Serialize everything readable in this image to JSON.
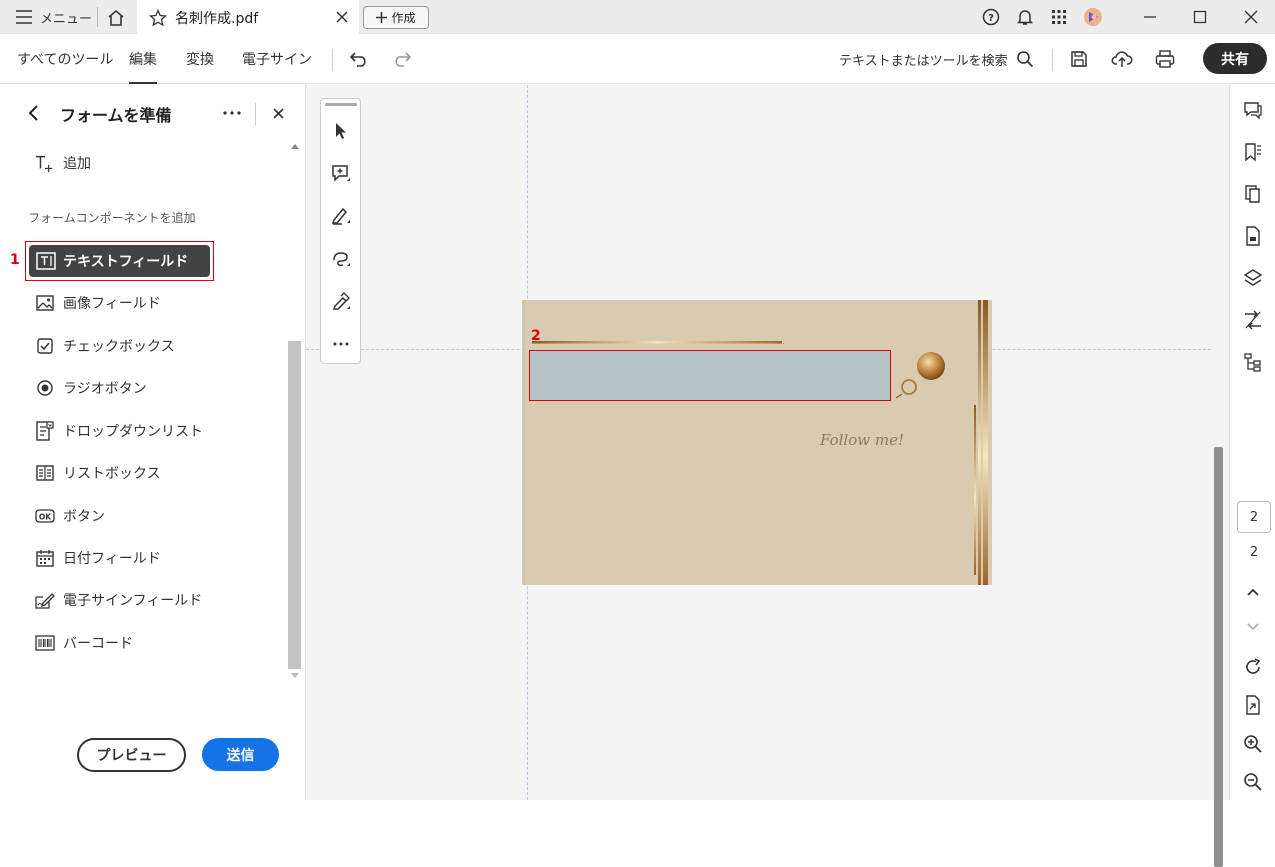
{
  "titlebar": {
    "menu_label": "メニュー",
    "tab_title": "名刺作成.pdf",
    "create_label": "作成"
  },
  "toolbar": {
    "menus": [
      "すべてのツール",
      "編集",
      "変換",
      "電子サイン"
    ],
    "active_menu": "編集",
    "search_label": "テキストまたはツールを検索",
    "share_label": "共有"
  },
  "sidebar": {
    "title": "フォームを準備",
    "add_label": "追加",
    "section_label": "フォームコンポーネントを追加",
    "selected_item": "テキストフィールド",
    "items": [
      {
        "label": "画像フィールド",
        "icon": "image-icon"
      },
      {
        "label": "チェックボックス",
        "icon": "checkbox-icon"
      },
      {
        "label": "ラジオボタン",
        "icon": "radio-icon"
      },
      {
        "label": "ドロップダウンリスト",
        "icon": "dropdown-icon"
      },
      {
        "label": "リストボックス",
        "icon": "listbox-icon"
      },
      {
        "label": "ボタン",
        "icon": "ok-button-icon"
      },
      {
        "label": "日付フィールド",
        "icon": "calendar-icon"
      },
      {
        "label": "電子サインフィールド",
        "icon": "signature-icon"
      },
      {
        "label": "バーコード",
        "icon": "barcode-icon"
      }
    ],
    "preview_label": "プレビュー",
    "send_label": "送信"
  },
  "annotations": {
    "label1": "1",
    "label2": "2"
  },
  "card": {
    "script_text": "Follow me!"
  },
  "pagenav": {
    "current": "2",
    "total": "2"
  },
  "colors": {
    "accent": "#1473e6",
    "highlight": "#d9000d",
    "card_bg": "#d9cbb2",
    "field_bg": "#b5c2c3"
  }
}
